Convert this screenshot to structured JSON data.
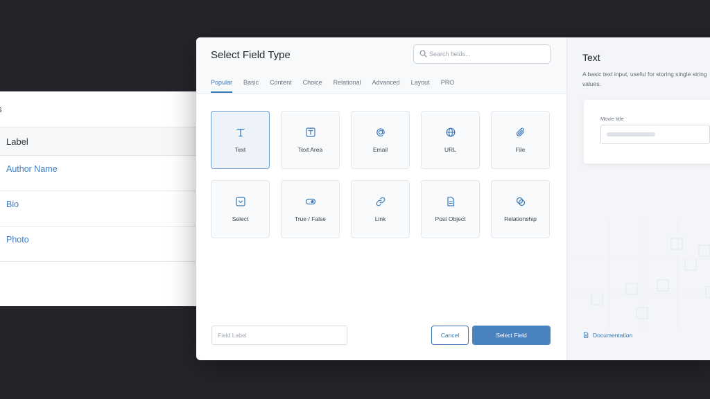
{
  "background_list": {
    "header_fragment": "s",
    "column_label": "Label",
    "rows": [
      "Author Name",
      "Bio",
      "Photo"
    ]
  },
  "modal": {
    "title": "Select Field Type",
    "search_placeholder": "Search fields...",
    "tabs": [
      {
        "label": "Popular",
        "active": true
      },
      {
        "label": "Basic",
        "active": false
      },
      {
        "label": "Content",
        "active": false
      },
      {
        "label": "Choice",
        "active": false
      },
      {
        "label": "Relational",
        "active": false
      },
      {
        "label": "Advanced",
        "active": false
      },
      {
        "label": "Layout",
        "active": false
      },
      {
        "label": "PRO",
        "active": false
      }
    ],
    "field_types": [
      {
        "label": "Text",
        "icon": "text-icon",
        "selected": true
      },
      {
        "label": "Text Area",
        "icon": "textarea-icon",
        "selected": false
      },
      {
        "label": "Email",
        "icon": "at-icon",
        "selected": false
      },
      {
        "label": "URL",
        "icon": "globe-icon",
        "selected": false
      },
      {
        "label": "File",
        "icon": "paperclip-icon",
        "selected": false
      },
      {
        "label": "Select",
        "icon": "select-icon",
        "selected": false
      },
      {
        "label": "True / False",
        "icon": "toggle-icon",
        "selected": false
      },
      {
        "label": "Link",
        "icon": "link-icon",
        "selected": false
      },
      {
        "label": "Post Object",
        "icon": "document-icon",
        "selected": false
      },
      {
        "label": "Relationship",
        "icon": "relationship-icon",
        "selected": false
      }
    ],
    "field_label_placeholder": "Field Label",
    "cancel_label": "Cancel",
    "select_label": "Select Field"
  },
  "side_panel": {
    "title": "Text",
    "description": "A basic text input, useful for storing single string values.",
    "preview_label": "Movie title",
    "doc_link": "Documentation"
  },
  "colors": {
    "accent": "#3a78b5",
    "primary_button": "#4a83bf",
    "backdrop": "#24252a",
    "link": "#3d7dbf"
  }
}
